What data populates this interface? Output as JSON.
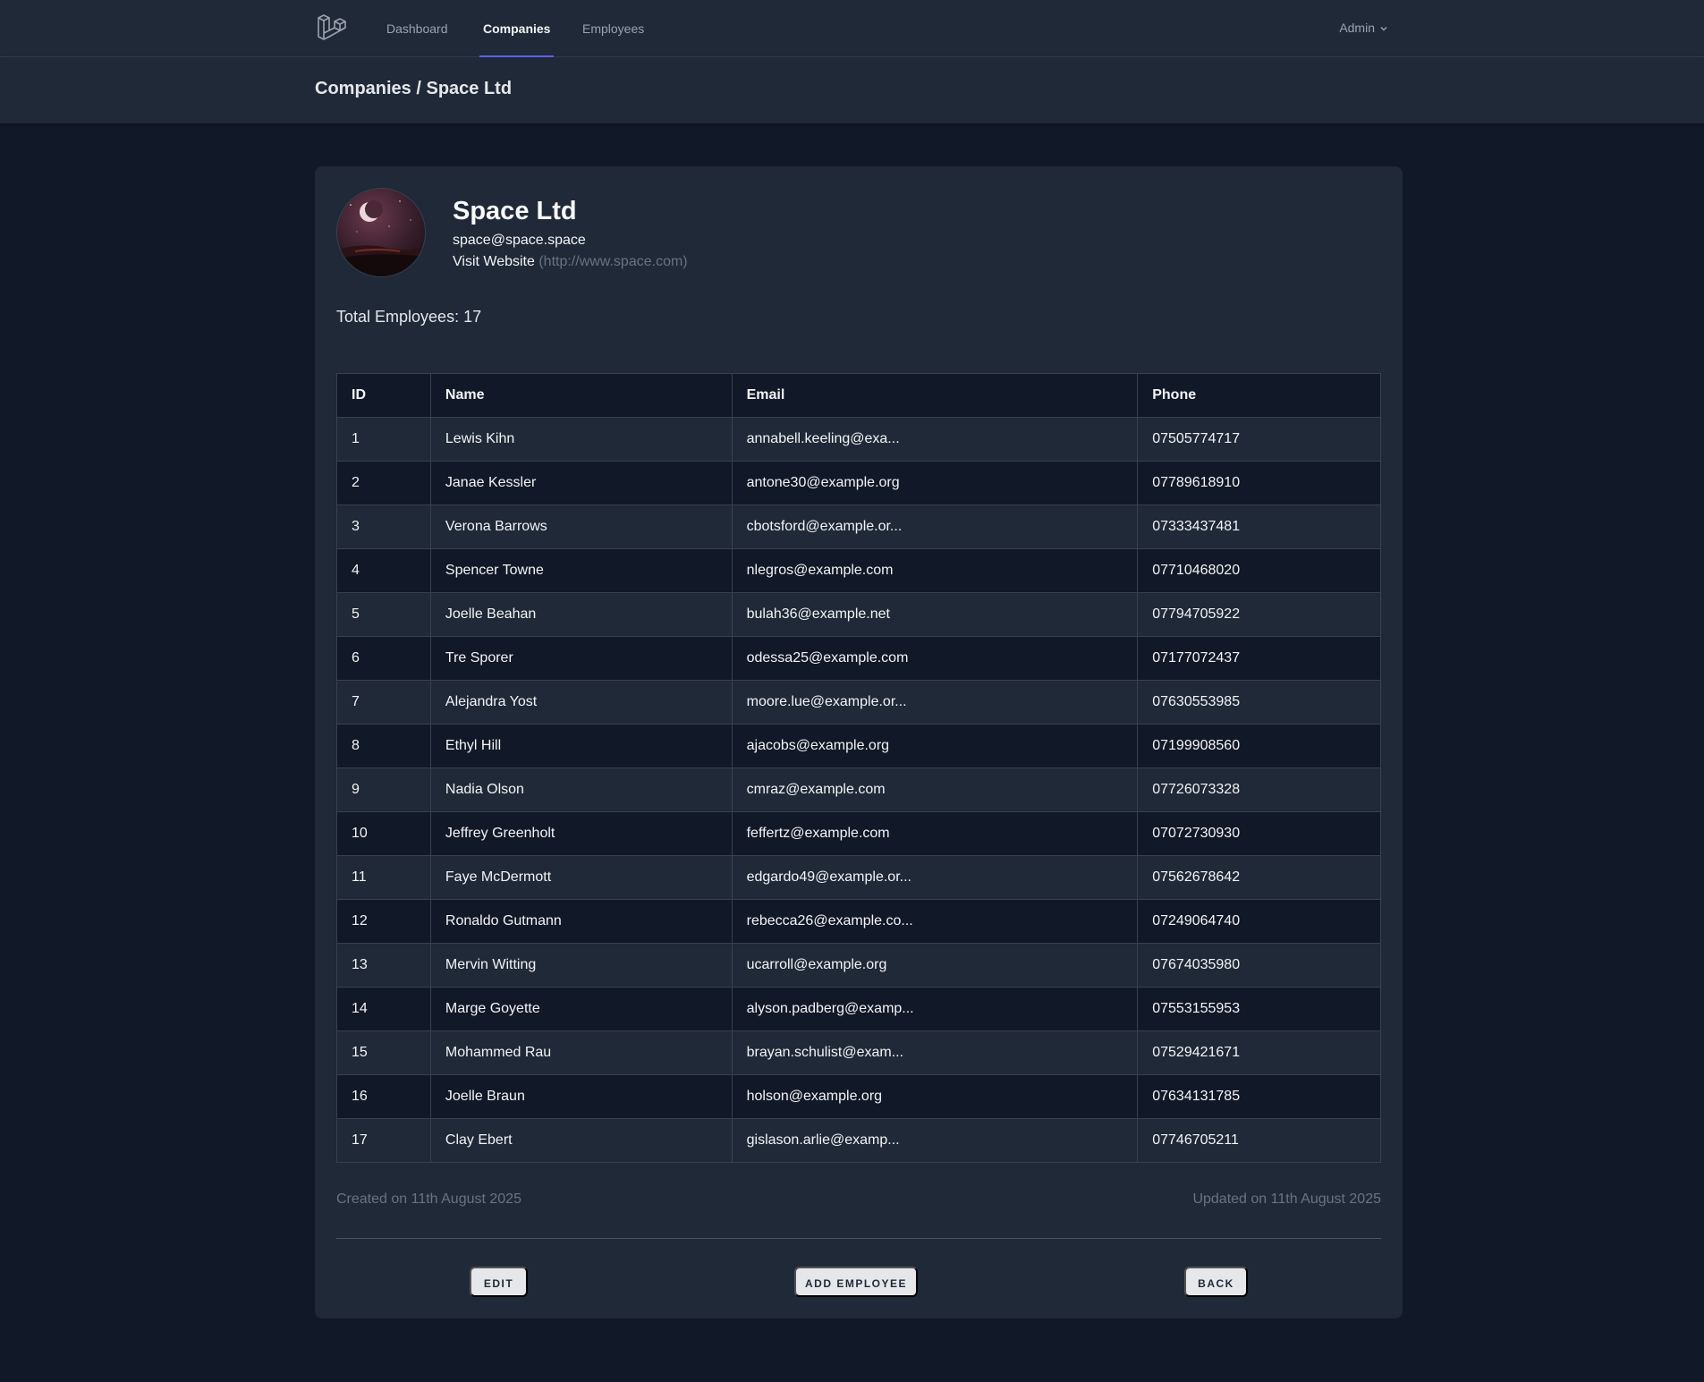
{
  "nav": {
    "links": [
      {
        "label": "Dashboard"
      },
      {
        "label": "Companies"
      },
      {
        "label": "Employees"
      }
    ],
    "user": "Admin"
  },
  "header": {
    "title": "Companies / Space Ltd"
  },
  "company": {
    "name": "Space Ltd",
    "email": "space@space.space",
    "website_label": "Visit Website",
    "website_url": "(http://www.space.com)",
    "total_employees_label": "Total Employees: 17"
  },
  "table": {
    "headers": [
      "ID",
      "Name",
      "Email",
      "Phone"
    ],
    "rows": [
      [
        "1",
        "Lewis Kihn",
        "annabell.keeling@exa...",
        "07505774717"
      ],
      [
        "2",
        "Janae Kessler",
        "antone30@example.org",
        "07789618910"
      ],
      [
        "3",
        "Verona Barrows",
        "cbotsford@example.or...",
        "07333437481"
      ],
      [
        "4",
        "Spencer Towne",
        "nlegros@example.com",
        "07710468020"
      ],
      [
        "5",
        "Joelle Beahan",
        "bulah36@example.net",
        "07794705922"
      ],
      [
        "6",
        "Tre Sporer",
        "odessa25@example.com",
        "07177072437"
      ],
      [
        "7",
        "Alejandra Yost",
        "moore.lue@example.or...",
        "07630553985"
      ],
      [
        "8",
        "Ethyl Hill",
        "ajacobs@example.org",
        "07199908560"
      ],
      [
        "9",
        "Nadia Olson",
        "cmraz@example.com",
        "07726073328"
      ],
      [
        "10",
        "Jeffrey Greenholt",
        "feffertz@example.com",
        "07072730930"
      ],
      [
        "11",
        "Faye McDermott",
        "edgardo49@example.or...",
        "07562678642"
      ],
      [
        "12",
        "Ronaldo Gutmann",
        "rebecca26@example.co...",
        "07249064740"
      ],
      [
        "13",
        "Mervin Witting",
        "ucarroll@example.org",
        "07674035980"
      ],
      [
        "14",
        "Marge Goyette",
        "alyson.padberg@examp...",
        "07553155953"
      ],
      [
        "15",
        "Mohammed Rau",
        "brayan.schulist@exam...",
        "07529421671"
      ],
      [
        "16",
        "Joelle Braun",
        "holson@example.org",
        "07634131785"
      ],
      [
        "17",
        "Clay Ebert",
        "gislason.arlie@examp...",
        "07746705211"
      ]
    ]
  },
  "meta": {
    "created": "Created on 11th August 2025",
    "updated": "Updated on 11th August 2025"
  },
  "actions": {
    "edit": "EDIT",
    "add_employee": "ADD EMPLOYEE",
    "back": "BACK"
  },
  "colors": {
    "accent": "#6366f1",
    "background": "#111827",
    "surface": "#1f2937"
  }
}
